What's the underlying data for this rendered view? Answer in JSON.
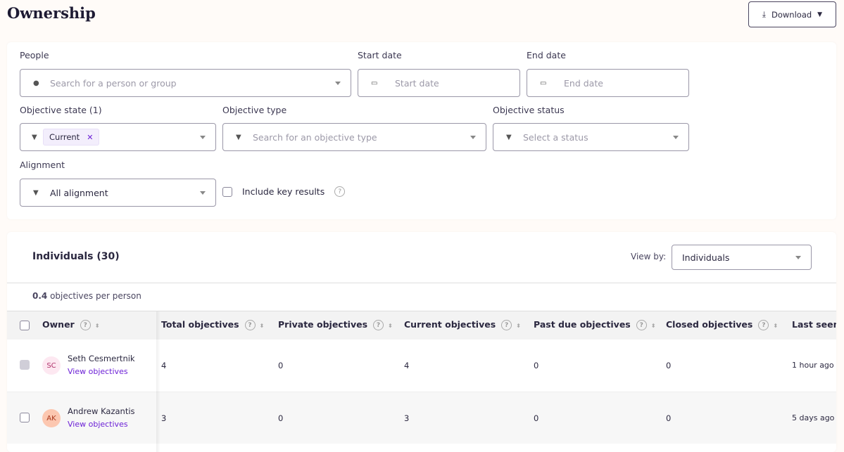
{
  "page": {
    "title": "Ownership",
    "download_label": "Download"
  },
  "filters": {
    "people": {
      "label": "People",
      "placeholder": "Search for a person or group"
    },
    "start_date": {
      "label": "Start date",
      "placeholder": "Start date"
    },
    "end_date": {
      "label": "End date",
      "placeholder": "End date"
    },
    "objective_state": {
      "label": "Objective state (1)",
      "chips": [
        "Current"
      ]
    },
    "objective_type": {
      "label": "Objective type",
      "placeholder": "Search for an objective type"
    },
    "objective_status": {
      "label": "Objective status",
      "placeholder": "Select a status"
    },
    "alignment": {
      "label": "Alignment",
      "value": "All alignment"
    },
    "include_key_results": {
      "label": "Include key results",
      "checked": false
    }
  },
  "table": {
    "title": "Individuals (30)",
    "view_by_label": "View by:",
    "view_by_value": "Individuals",
    "summary_value": "0.4",
    "summary_text": "objectives per person",
    "columns": [
      "Owner",
      "Total objectives",
      "Private objectives",
      "Current objectives",
      "Past due objectives",
      "Closed objectives",
      "Last seen"
    ],
    "rows": [
      {
        "initials": "SC",
        "name": "Seth Cesmertnik",
        "link": "View objectives",
        "total": "4",
        "private": "0",
        "current": "4",
        "past_due": "0",
        "closed": "0",
        "last_seen": "1 hour ago",
        "avatar_bg": "#fde8f1",
        "avatar_fg": "#b0306a"
      },
      {
        "initials": "AK",
        "name": "Andrew Kazantis",
        "link": "View objectives",
        "total": "3",
        "private": "0",
        "current": "3",
        "past_due": "0",
        "closed": "0",
        "last_seen": "5 days ago",
        "avatar_bg": "#fcc7b0",
        "avatar_fg": "#a8361a"
      }
    ]
  },
  "colors": {
    "accent": "#6b1fd6"
  }
}
